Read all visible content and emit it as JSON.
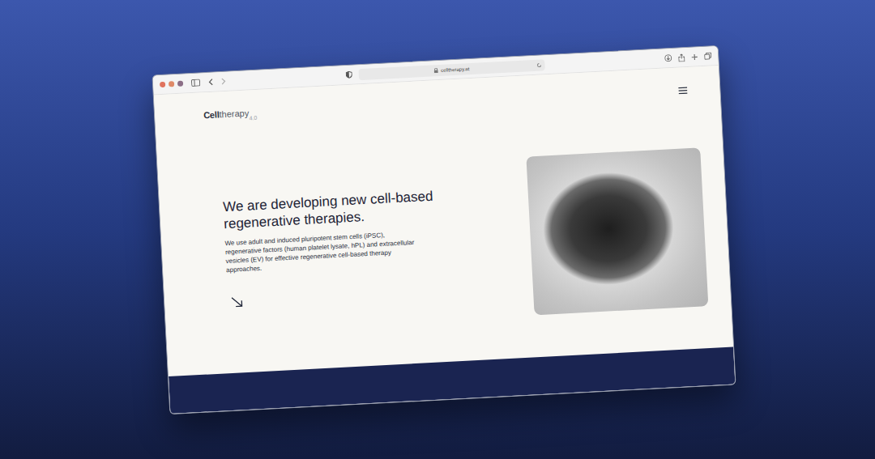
{
  "browser": {
    "url": "celltherapy.at"
  },
  "page": {
    "logo": {
      "bold": "Cell",
      "light": "therapy",
      "version": "4.0"
    },
    "heading": "We are developing new cell-based regenerative therapies.",
    "body": "We use adult and induced pluripotent stem cells (iPSC), regenerative factors (human platelet lysate, hPL) and extracellular vesicles (EV) for effective regenerative cell-based therapy approaches."
  }
}
